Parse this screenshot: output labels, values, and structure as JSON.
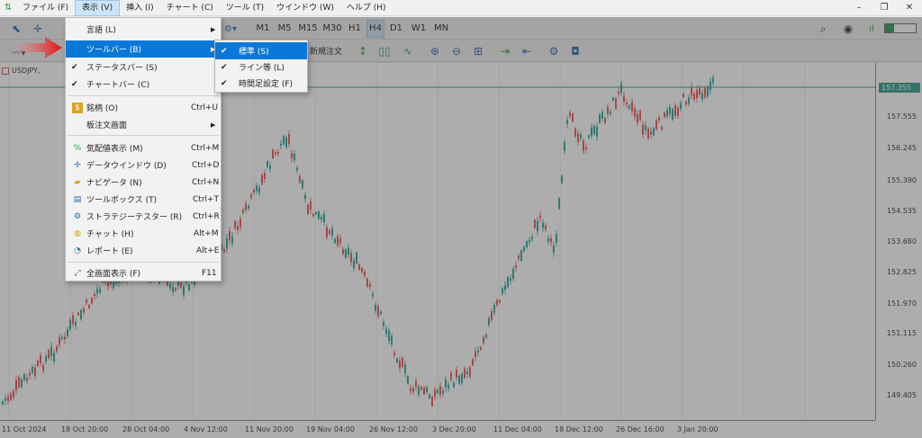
{
  "menubar": {
    "items": [
      "ファイル (F)",
      "表示 (V)",
      "挿入 (I)",
      "チャート (C)",
      "ツール (T)",
      "ウインドウ (W)",
      "ヘルプ (H)"
    ]
  },
  "timeframes": [
    "M1",
    "M5",
    "M15",
    "M30",
    "H1",
    "H4",
    "D1",
    "W1",
    "MN"
  ],
  "active_timeframe": "H4",
  "toolbar2": {
    "new_order_label": "新規注文"
  },
  "chart": {
    "symbol_tab": "USDJPY,",
    "current_price": "157.355",
    "price_labels": [
      "157.555",
      "156.245",
      "155.390",
      "154.535",
      "153.680",
      "152.825",
      "151.970",
      "151.115",
      "150.260",
      "149.405"
    ],
    "time_labels": [
      "11 Oct 2024",
      "18 Oct 20:00",
      "28 Oct 04:00",
      "4 Nov 12:00",
      "11 Nov 20:00",
      "19 Nov 04:00",
      "26 Nov 12:00",
      "3 Dec 20:00",
      "11 Dec 04:00",
      "18 Dec 12:00",
      "26 Dec 16:00",
      "3 Jan 20:00"
    ],
    "bull_color": "#26a69a",
    "bear_color": "#ef5350"
  },
  "view_menu": {
    "language": "言語 (L)",
    "toolbar": "ツールバー (B)",
    "status_bar": "ステータスバー (S)",
    "chart_bar": "チャートバー (C)",
    "symbols": "銘柄 (O)",
    "symbols_shortcut": "Ctrl+U",
    "depth_of_market": "板注文画面",
    "market_watch": "気配値表示 (M)",
    "market_watch_shortcut": "Ctrl+M",
    "data_window": "データウインドウ (D)",
    "data_window_shortcut": "Ctrl+D",
    "navigator": "ナビゲータ (N)",
    "navigator_shortcut": "Ctrl+N",
    "toolbox": "ツールボックス (T)",
    "toolbox_shortcut": "Ctrl+T",
    "strategy_tester": "ストラテジーテスター (R)",
    "strategy_tester_shortcut": "Ctrl+R",
    "chat": "チャット (H)",
    "chat_shortcut": "Alt+M",
    "reports": "レポート (E)",
    "reports_shortcut": "Alt+E",
    "fullscreen": "全画面表示 (F)",
    "fullscreen_shortcut": "F11"
  },
  "toolbar_submenu": {
    "standard": "標準 (S)",
    "line_studies": "ライン等 (L)",
    "timeframes": "時間足設定 (F)"
  }
}
